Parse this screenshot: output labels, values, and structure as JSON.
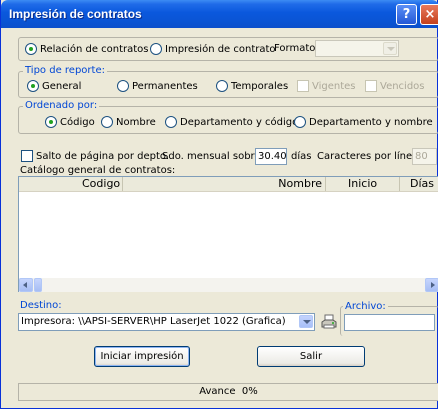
{
  "window": {
    "title": "Impresión de contratos",
    "help_label": "?",
    "close_label": "×"
  },
  "print_mode": {
    "option1": "Relación de contratos",
    "option2": "Impresión de contrato",
    "selected": "Relación de contratos",
    "format_label": "Formato:",
    "format_value": ""
  },
  "report_type": {
    "legend": "Tipo de reporte:",
    "options": [
      "General",
      "Permanentes",
      "Temporales"
    ],
    "selected": "General",
    "check_vigentes": "Vigentes",
    "check_vencidos": "Vencidos"
  },
  "sort": {
    "legend": "Ordenado por:",
    "options": [
      "Código",
      "Nombre",
      "Departamento y código",
      "Departamento y nombre"
    ],
    "selected": "Código"
  },
  "options_row": {
    "page_break_label": "Salto de página por depto.",
    "monthly_label": "Sdo. mensual sobre:",
    "monthly_value": "30.40",
    "days_label": "días",
    "chars_label": "Caracteres por línea:",
    "chars_value": "80"
  },
  "catalog": {
    "title": "Catálogo general de contratos:",
    "columns": [
      "Codigo",
      "Nombre",
      "Inicio",
      "Días"
    ],
    "rows": []
  },
  "destination": {
    "legend": "Destino:",
    "printer": "Impresora: \\\\APSI-SERVER\\HP LaserJet 1022 (Grafica)",
    "printer_icon": "printer-icon"
  },
  "file": {
    "legend": "Archivo:",
    "value": ""
  },
  "buttons": {
    "start": "Iniciar impresión",
    "exit": "Salir"
  },
  "progress": {
    "label": "Avance",
    "text": "Avance  0%",
    "value": 0
  },
  "colors": {
    "title_bar": "#0a58dd",
    "legend_text": "#0046d5",
    "radio_dot": "#21a121"
  }
}
